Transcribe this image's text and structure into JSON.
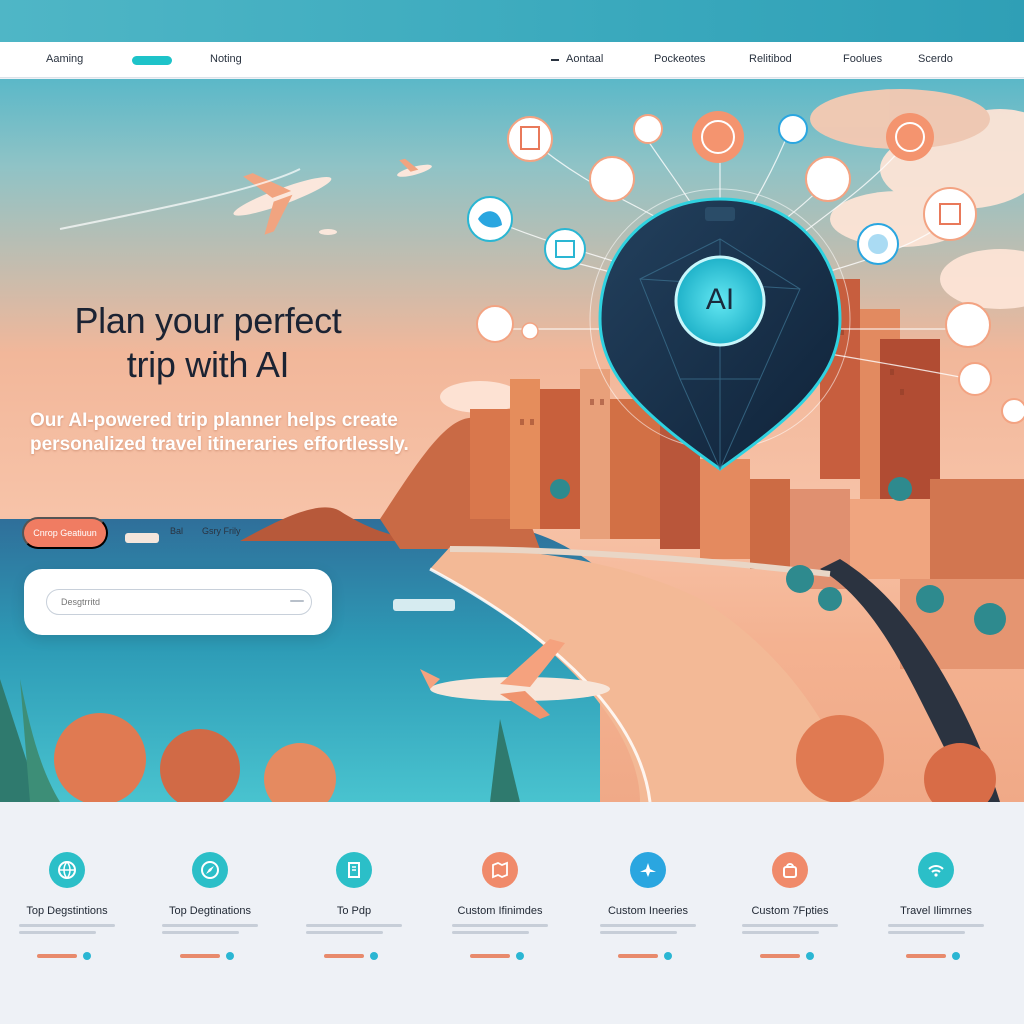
{
  "nav": {
    "left_items": [
      "Aaming",
      "Noting"
    ],
    "right_items": [
      "Aontaal",
      "Pockeotes",
      "Relitibod",
      "Foolues",
      "Scerdo"
    ]
  },
  "hero": {
    "title_line1": "Plan your perfect",
    "title_line2": "trip with AI",
    "subtitle": "Our AI-powered trip planner helps create personalized travel itineraries effortlessly.",
    "cta_label": "Cnrop Geatiuun",
    "mini_link_1": "Bal",
    "mini_link_2": "Gsry Frily",
    "search_placeholder": "Desgtrritd",
    "ai_badge": "AI"
  },
  "features": [
    {
      "title": "Top Degstintions",
      "icon": "globe-icon",
      "color": "#2bbfc8"
    },
    {
      "title": "Top Degtinations",
      "icon": "compass-icon",
      "color": "#2bbfc8"
    },
    {
      "title": "To Pdp",
      "icon": "document-icon",
      "color": "#2bbfc8"
    },
    {
      "title": "Custom Ifinimdes",
      "icon": "map-icon",
      "color": "#f08a6a"
    },
    {
      "title": "Custom Ineeries",
      "icon": "plane-icon",
      "color": "#2aa6e0"
    },
    {
      "title": "Custom 7Fpties",
      "icon": "bag-icon",
      "color": "#f08a6a"
    },
    {
      "title": "Travel Ilimrnes",
      "icon": "wifi-icon",
      "color": "#2bbfc8"
    }
  ],
  "colors": {
    "accent_teal": "#1ec3c9",
    "accent_coral": "#f07c62",
    "dark_text": "#1b2333"
  }
}
